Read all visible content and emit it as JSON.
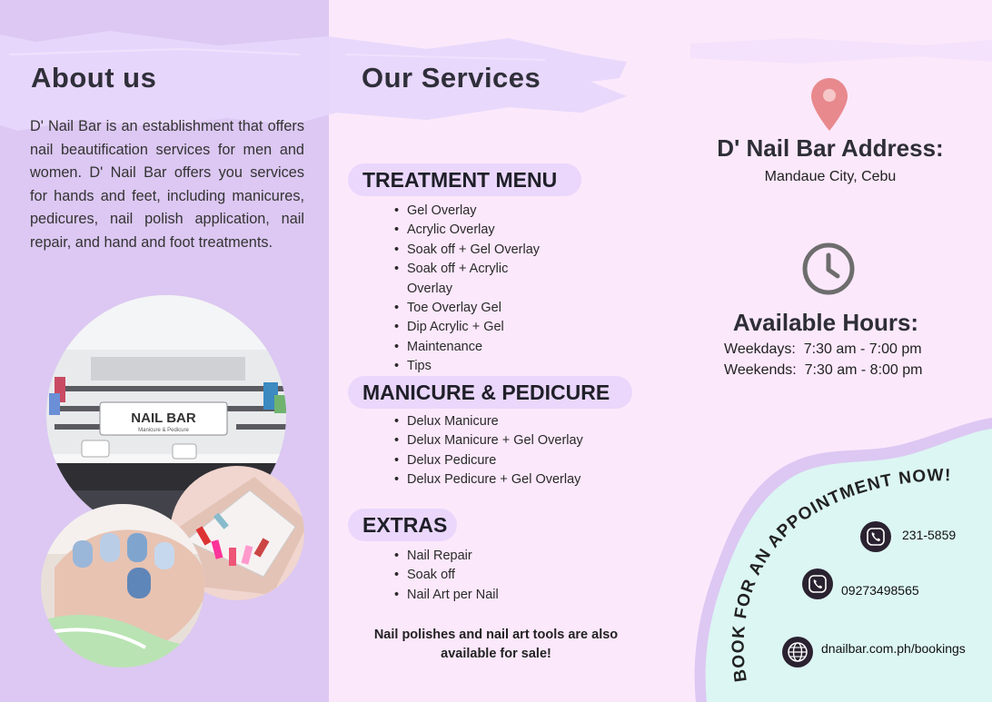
{
  "about": {
    "title": "About us",
    "text": "D' Nail Bar is an establishment that offers nail beautification services for men and women. D' Nail Bar offers you services for hands and feet, including manicures, pedicures, nail polish application, nail repair, and hand and foot treatments."
  },
  "salon_sign": {
    "name": "NAIL BAR",
    "sub": "Manicure & Pedicure"
  },
  "services": {
    "title": "Our Services",
    "sections": [
      {
        "heading": "TREATMENT MENU",
        "items": [
          "Gel Overlay",
          "Acrylic Overlay",
          "Soak off + Gel Overlay",
          "Soak off + Acrylic Overlay",
          "Toe Overlay Gel",
          "Dip Acrylic + Gel",
          "Maintenance",
          "Tips"
        ]
      },
      {
        "heading": "MANICURE & PEDICURE",
        "items": [
          "Delux Manicure",
          "Delux Manicure + Gel Overlay",
          "Delux Pedicure",
          "Delux Pedicure + Gel Overlay"
        ]
      },
      {
        "heading": "EXTRAS",
        "items": [
          "Nail Repair",
          "Soak off",
          "Nail Art per Nail"
        ]
      }
    ],
    "note": "Nail polishes and nail art tools are also available for sale!"
  },
  "address": {
    "title": "D' Nail Bar Address:",
    "text": "Mandaue City, Cebu"
  },
  "hours": {
    "title": "Available Hours:",
    "weekdays": "Weekdays:  7:30 am - 7:00 pm",
    "weekends": "Weekends:  7:30 am - 8:00 pm"
  },
  "booking": {
    "cta": "BOOK FOR AN APPOINTMENT NOW!",
    "phone": "231-5859",
    "mobile": "09273498565",
    "website": "dnailbar.com.ph/bookings"
  },
  "colors": {
    "left_panel": "#dcc8f2",
    "page_bg": "#fbe8fb",
    "pill_bg": "#ead7fb",
    "booking_bg": "#dcf6f3",
    "pin": "#e8898d"
  }
}
